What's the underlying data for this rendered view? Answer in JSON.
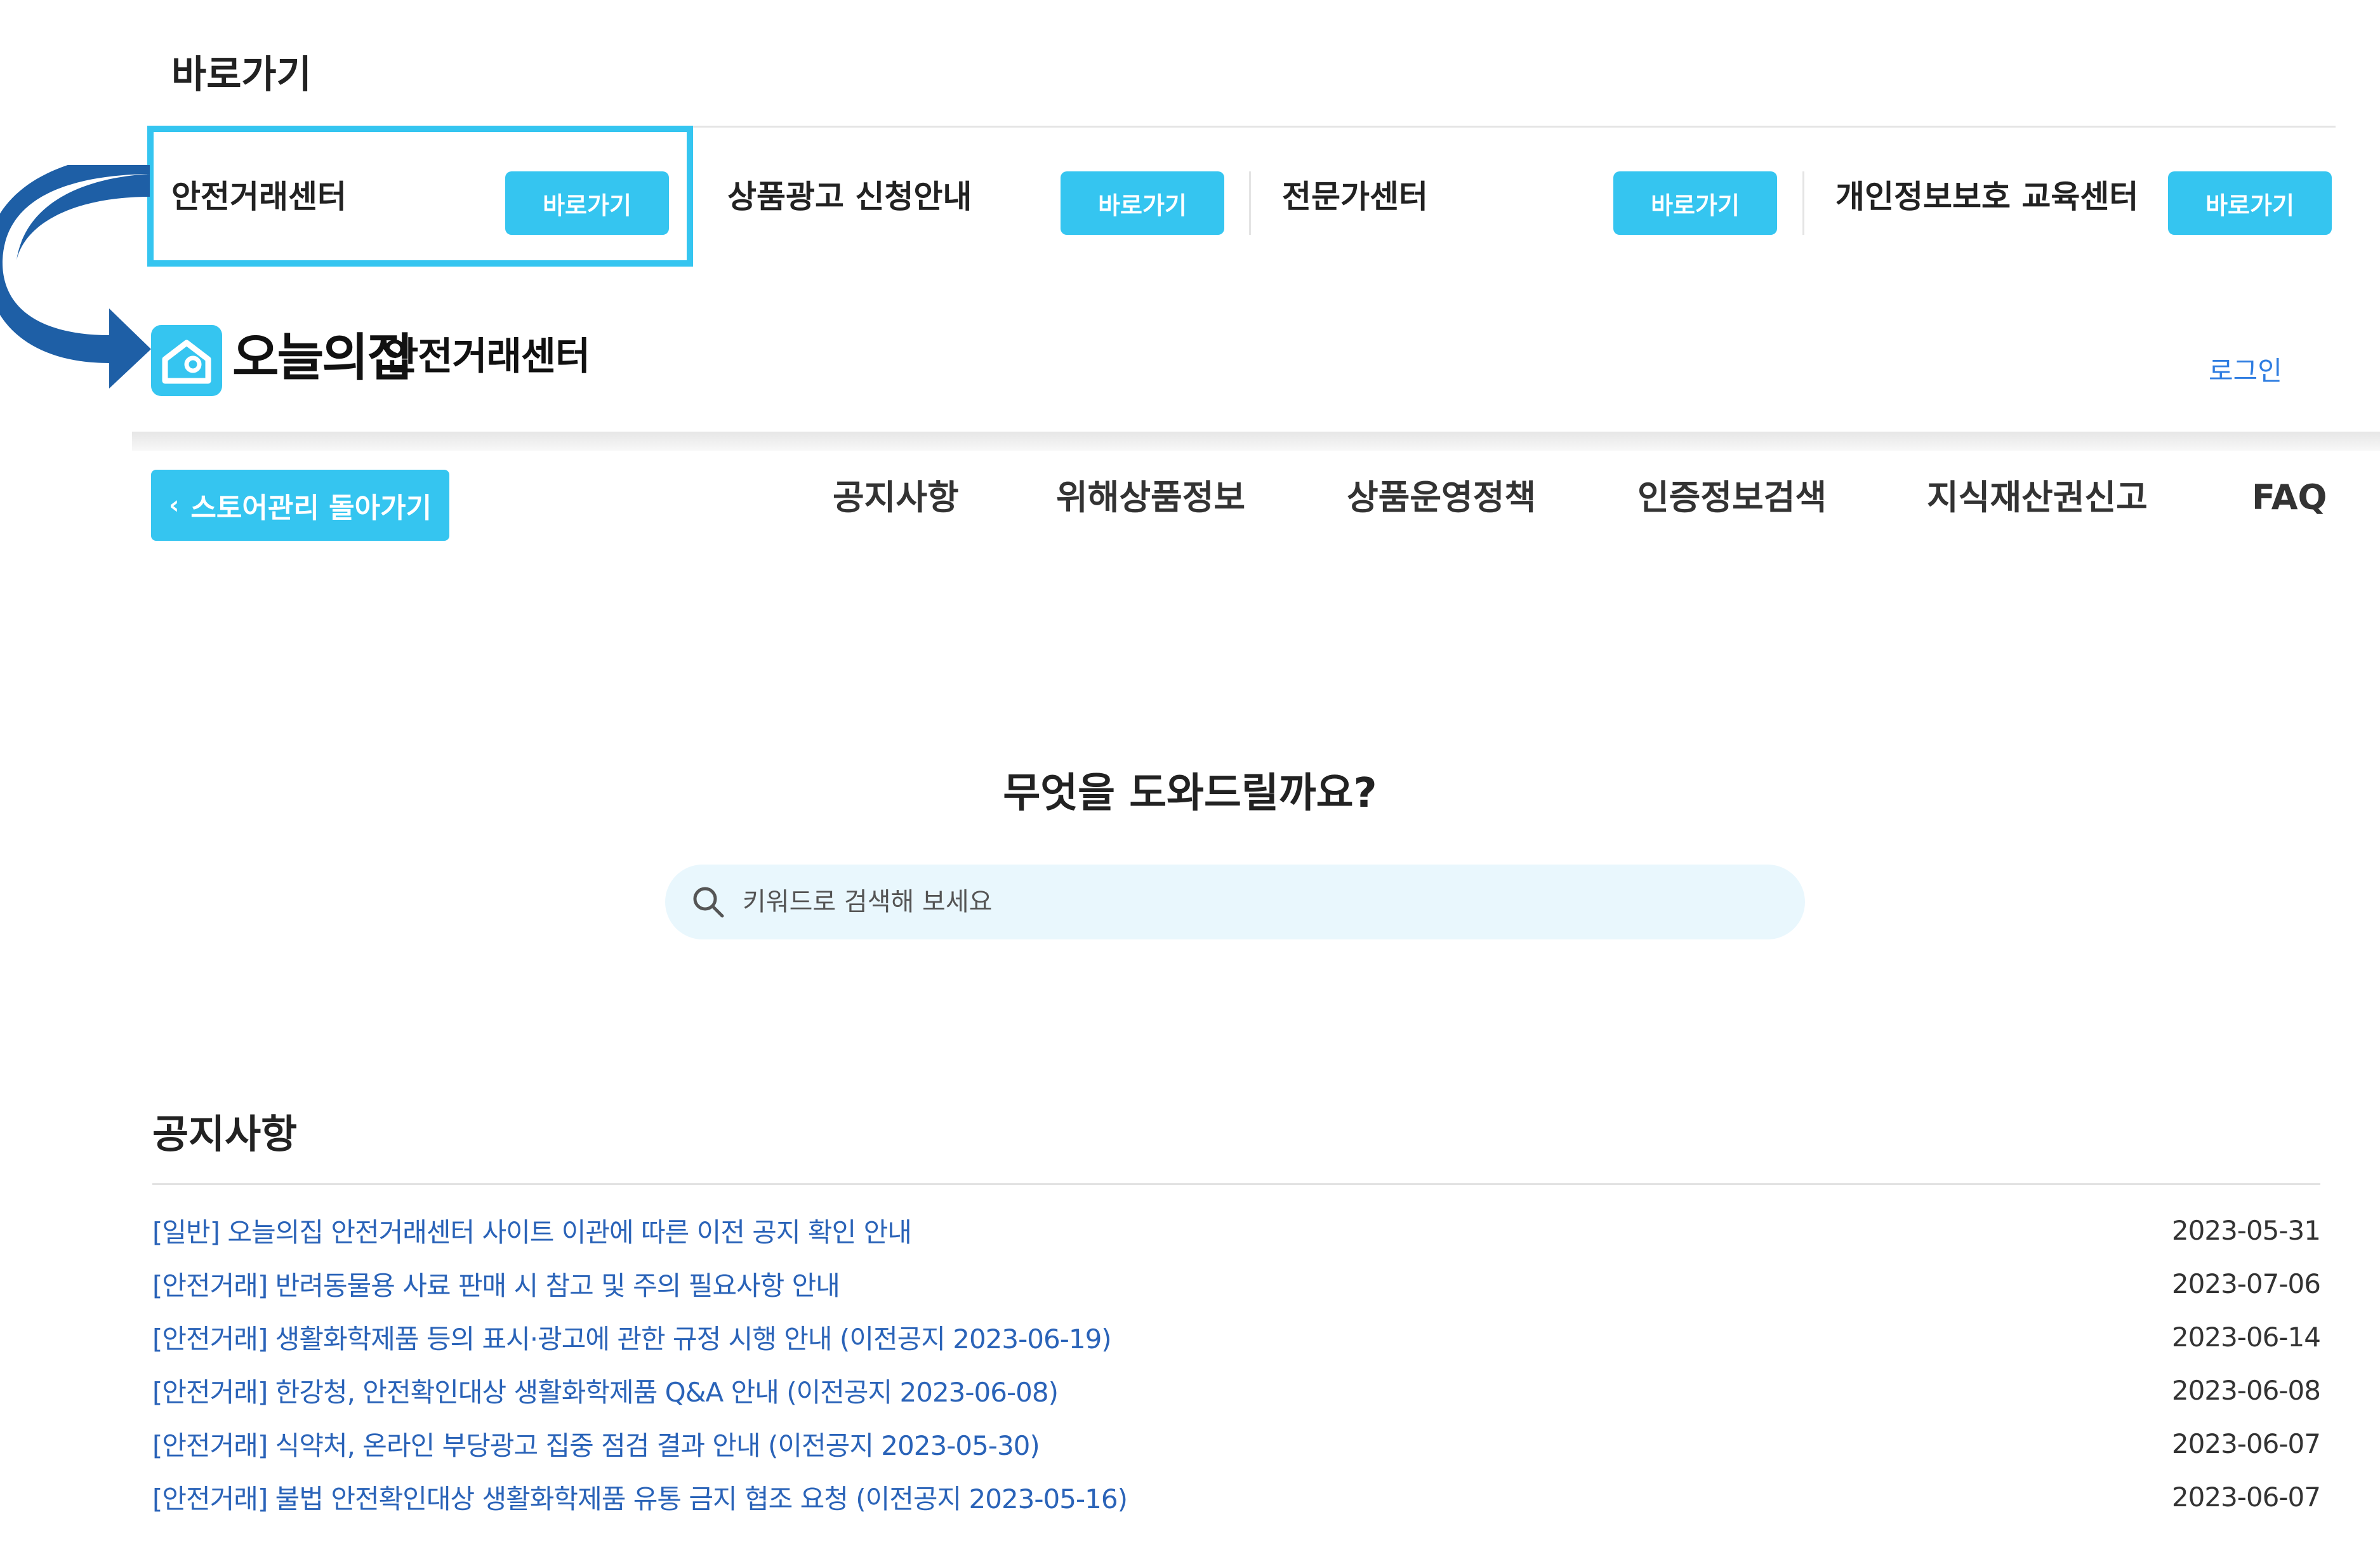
{
  "quick_links": {
    "title": "바로가기",
    "items": [
      {
        "label": "안전거래센터",
        "button": "바로가기"
      },
      {
        "label": "상품광고 신청안내",
        "button": "바로가기"
      },
      {
        "label": "전문가센터",
        "button": "바로가기"
      },
      {
        "label": "개인정보보호 교육센터",
        "button": "바로가기"
      }
    ]
  },
  "header": {
    "brand": "오늘의집",
    "subtitle": "안전거래센터",
    "login": "로그인"
  },
  "nav": {
    "back_button": "스토어관리 돌아가기",
    "items": [
      "공지사항",
      "위해상품정보",
      "상품운영정책",
      "인증정보검색",
      "지식재산권신고",
      "FAQ"
    ]
  },
  "search": {
    "title": "무엇을 도와드릴까요?",
    "placeholder": "키워드로 검색해 보세요"
  },
  "notices": {
    "title": "공지사항",
    "items": [
      {
        "title": "[일반] 오늘의집 안전거래센터 사이트 이관에 따른 이전 공지 확인 안내",
        "date": "2023-05-31"
      },
      {
        "title": "[안전거래] 반려동물용 사료 판매 시 참고 및 주의 필요사항 안내",
        "date": "2023-07-06"
      },
      {
        "title": "[안전거래] 생활화학제품 등의 표시·광고에 관한 규정 시행 안내 (이전공지 2023-06-19)",
        "date": "2023-06-14"
      },
      {
        "title": "[안전거래] 한강청, 안전확인대상 생활화학제품 Q&A 안내 (이전공지 2023-06-08)",
        "date": "2023-06-08"
      },
      {
        "title": "[안전거래] 식약처, 온라인 부당광고 집중 점검 결과 안내 (이전공지 2023-05-30)",
        "date": "2023-06-07"
      },
      {
        "title": "[안전거래] 불법 안전확인대상 생활화학제품 유통 금지 협조 요청 (이전공지 2023-05-16)",
        "date": "2023-06-07"
      }
    ]
  },
  "colors": {
    "accent": "#35c5f0",
    "arrow": "#1e5fa6",
    "link": "#2a63b8"
  }
}
